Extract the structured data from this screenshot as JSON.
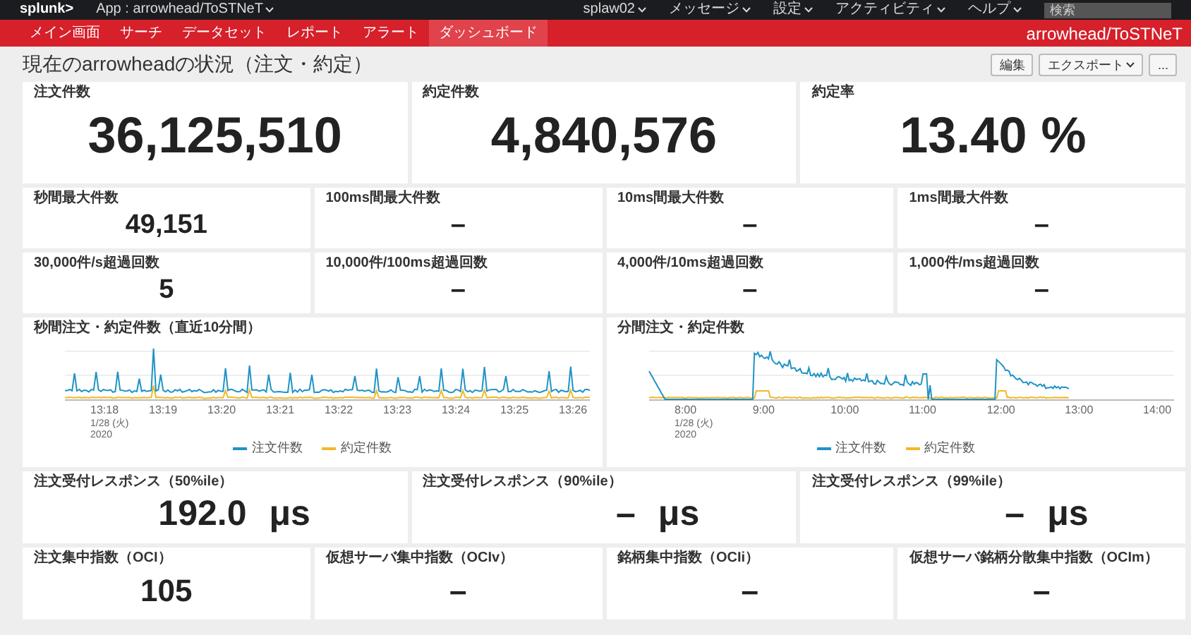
{
  "top_bar": {
    "logo": "splunk>",
    "app": "App : arrowhead/ToSTNeT",
    "menus": [
      "splaw02",
      "メッセージ",
      "設定",
      "アクティビティ",
      "ヘルプ"
    ],
    "search": {
      "placeholder": "検索"
    }
  },
  "nav": {
    "items": [
      {
        "label": "メイン画面",
        "selected": false
      },
      {
        "label": "サーチ",
        "selected": false
      },
      {
        "label": "データセット",
        "selected": false
      },
      {
        "label": "レポート",
        "selected": false
      },
      {
        "label": "アラート",
        "selected": false
      },
      {
        "label": "ダッシュボード",
        "selected": true
      }
    ],
    "app_name": "arrowhead/ToSTNeT"
  },
  "dashboard": {
    "title": "現在のarrowheadの状況（注文・約定）",
    "buttons": [
      {
        "label": "編集",
        "kind": "plain"
      },
      {
        "label": "エクスポート",
        "kind": "dropdown"
      },
      {
        "label": "...",
        "kind": "plain"
      }
    ]
  },
  "rows": [
    {
      "kind": "stats",
      "panels": [
        {
          "title": "注文件数",
          "value": "36,125,510"
        },
        {
          "title": "約定件数",
          "value": "4,840,576"
        },
        {
          "title": "約定率",
          "value": "13.40 %"
        }
      ]
    },
    {
      "kind": "stats",
      "panels": [
        {
          "title": "秒間最大件数",
          "value": "49,151"
        },
        {
          "title": "100ms間最大件数",
          "value": "–"
        },
        {
          "title": "10ms間最大件数",
          "value": "–"
        },
        {
          "title": "1ms間最大件数",
          "value": "–"
        }
      ]
    },
    {
      "kind": "stats",
      "panels": [
        {
          "title": "30,000件/s超過回数",
          "value": "5"
        },
        {
          "title": "10,000件/100ms超過回数",
          "value": "–"
        },
        {
          "title": "4,000件/10ms超過回数",
          "value": "–"
        },
        {
          "title": "1,000件/ms超過回数",
          "value": "–"
        }
      ]
    },
    {
      "kind": "charts",
      "panels": [
        {
          "title": "秒間注文・約定件数（直近10分間）",
          "kind": "seconds",
          "x_labels": [
            "13:18",
            "13:19",
            "13:20",
            "13:21",
            "13:22",
            "13:23",
            "13:24",
            "13:25",
            "13:26"
          ],
          "date_lines": [
            "1/28 (火)",
            "2020"
          ],
          "legend": [
            {
              "label": "注文件数",
              "color": "#1e93c6"
            },
            {
              "label": "約定件数",
              "color": "#f2b827"
            }
          ]
        },
        {
          "title": "分間注文・約定件数",
          "kind": "minutes",
          "x_labels": [
            "8:00",
            "9:00",
            "10:00",
            "11:00",
            "12:00",
            "13:00",
            "14:00"
          ],
          "date_lines": [
            "1/28 (火)",
            "2020"
          ],
          "legend": [
            {
              "label": "注文件数",
              "color": "#1e93c6"
            },
            {
              "label": "約定件数",
              "color": "#f2b827"
            }
          ]
        }
      ]
    },
    {
      "kind": "stats",
      "panels": [
        {
          "title": "注文受付レスポンス（50%ile）",
          "value": "192.0",
          "unit": "μs"
        },
        {
          "title": "注文受付レスポンス（90%ile）",
          "value": "–",
          "unit": "μs"
        },
        {
          "title": "注文受付レスポンス（99%ile）",
          "value": "–",
          "unit": "μs"
        }
      ]
    },
    {
      "kind": "stats",
      "panels": [
        {
          "title": "注文集中指数（OCI）",
          "value": "105"
        },
        {
          "title": "仮想サーバ集中指数（OCIv）",
          "value": "–"
        },
        {
          "title": "銘柄集中指数（OCIi）",
          "value": "–"
        },
        {
          "title": "仮想サーバ銘柄分散集中指数（OCIm）",
          "value": "–"
        }
      ]
    }
  ]
}
